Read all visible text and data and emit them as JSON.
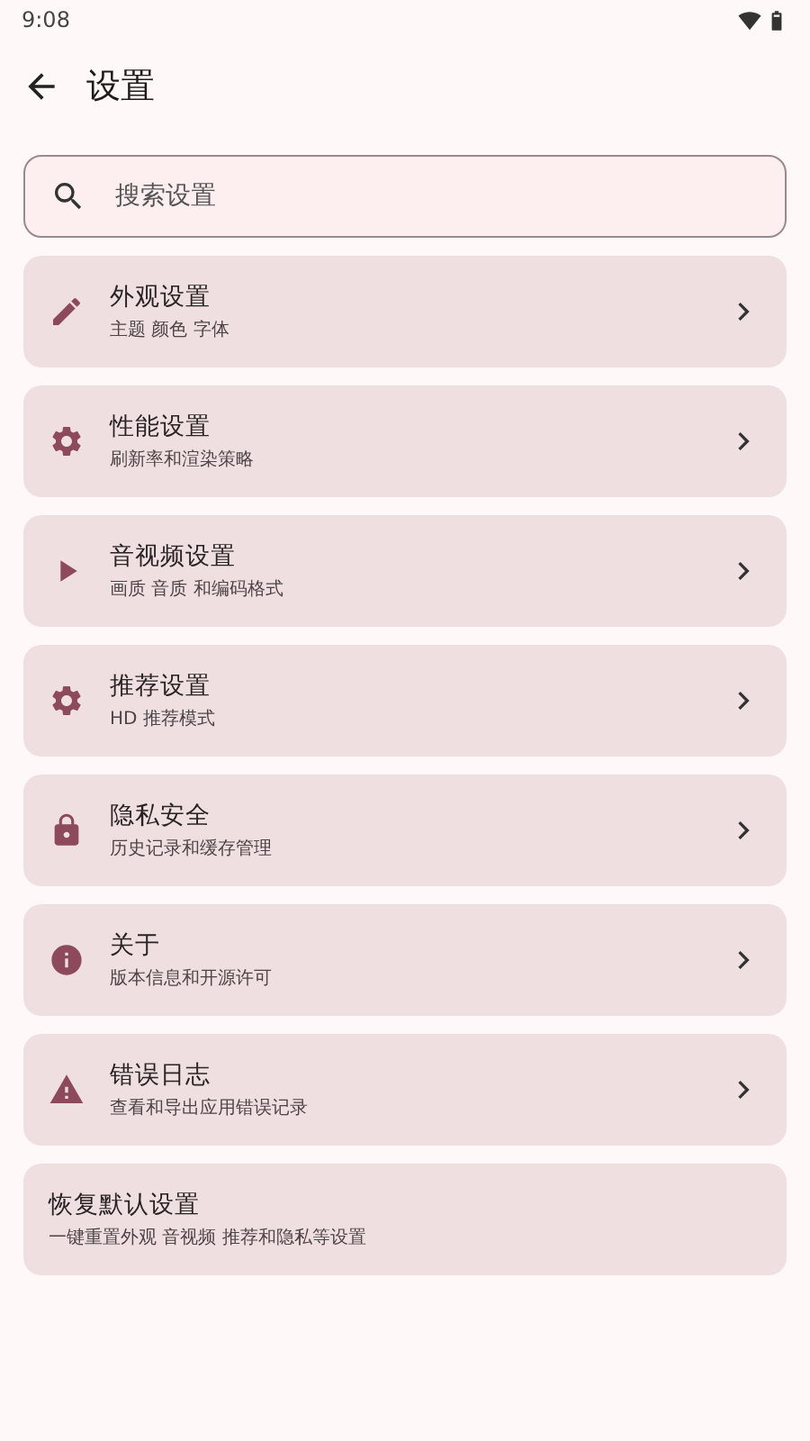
{
  "status_bar": {
    "time": "9:08"
  },
  "header": {
    "title": "设置"
  },
  "search": {
    "placeholder": "搜索设置"
  },
  "items": [
    {
      "kind": "pencil",
      "title": "外观设置",
      "subtitle": "主题 颜色 字体"
    },
    {
      "kind": "gear",
      "title": "性能设置",
      "subtitle": "刷新率和渲染策略"
    },
    {
      "kind": "play",
      "title": "音视频设置",
      "subtitle": "画质 音质 和编码格式"
    },
    {
      "kind": "gear",
      "title": "推荐设置",
      "subtitle": "HD 推荐模式"
    },
    {
      "kind": "lock",
      "title": "隐私安全",
      "subtitle": "历史记录和缓存管理"
    },
    {
      "kind": "info",
      "title": "关于",
      "subtitle": "版本信息和开源许可"
    },
    {
      "kind": "warning",
      "title": "错误日志",
      "subtitle": "查看和导出应用错误记录"
    },
    {
      "kind": "plain",
      "title": "恢复默认设置",
      "subtitle": "一键重置外观 音视频 推荐和隐私等设置"
    }
  ]
}
